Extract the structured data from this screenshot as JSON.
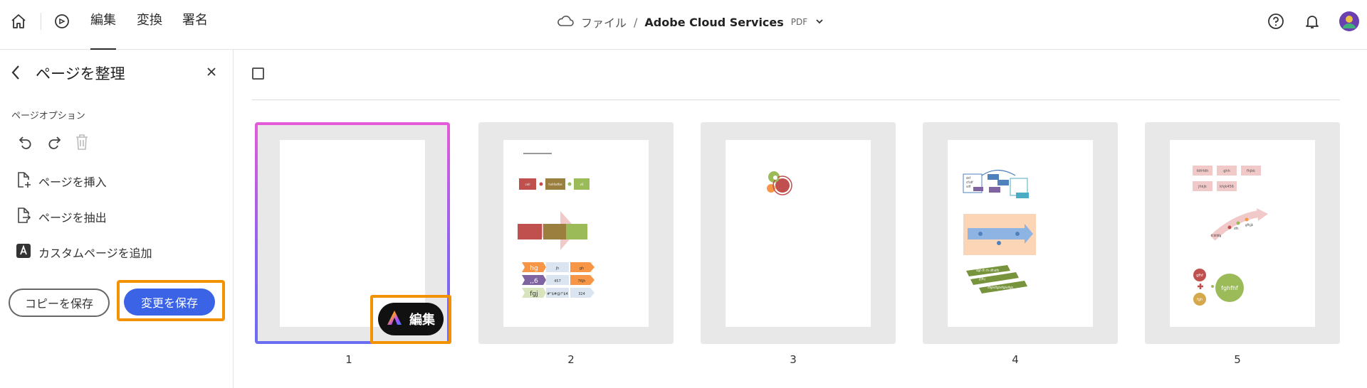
{
  "header": {
    "tabs": [
      {
        "label": "編集",
        "active": true
      },
      {
        "label": "変換",
        "active": false
      },
      {
        "label": "署名",
        "active": false
      }
    ],
    "breadcrumb": {
      "file_label": "ファイル",
      "separator": "/",
      "title": "Adobe Cloud Services",
      "file_type": "PDF"
    },
    "icons": [
      "home-icon",
      "pen-tool-icon",
      "cloud-icon",
      "chevron-down-icon",
      "help-icon",
      "bell-icon",
      "avatar"
    ]
  },
  "panel": {
    "title": "ページを整理",
    "options_label": "ページオプション",
    "menu": [
      {
        "label": "ページを挿入",
        "icon": "insert-page-icon"
      },
      {
        "label": "ページを抽出",
        "icon": "extract-page-icon"
      },
      {
        "label": "カスタムページを追加",
        "icon": "adobe-custom-page-icon"
      }
    ],
    "copy_button": "コピーを保存",
    "save_button": "変更を保存"
  },
  "main": {
    "pages": [
      {
        "number": "1",
        "selected": true
      },
      {
        "number": "2",
        "selected": false
      },
      {
        "number": "3",
        "selected": false
      },
      {
        "number": "4",
        "selected": false
      },
      {
        "number": "5",
        "selected": false
      }
    ],
    "edit_button": "編集",
    "page2_text": {
      "heading": "",
      "row1": [
        "cell",
        "hshfsdfse",
        "v0"
      ],
      "hg_rows": [
        "hg",
        "jh",
        "gh",
        ",,6",
        "457",
        "76jh",
        "fgj",
        "#\"$#@!\"$4",
        "324"
      ]
    },
    "page4_text": {
      "bullets": [
        "dsf",
        "cfsdf",
        "sdf"
      ],
      "bars": [
        "dgh fh fh dfhdfh",
        "jfjfhj",
        "dfghdfghdfghdfgh"
      ]
    },
    "page5_text": {
      "row1": [
        "fdfrfdh",
        "ghh",
        "fhjkk"
      ],
      "row2": [
        "jhkjk",
        "khjk456"
      ],
      "arrow": [
        "fchfdfg",
        "dfh",
        "gfhjjk"
      ],
      "circles": [
        "gfhf",
        "fgh",
        "fghfhf"
      ]
    }
  },
  "colors": {
    "accent_blue": "#3b63e5",
    "highlight_orange": "#f39200",
    "selection_gradient_top": "#e55ad8",
    "selection_gradient_bottom": "#6a6cf2"
  }
}
